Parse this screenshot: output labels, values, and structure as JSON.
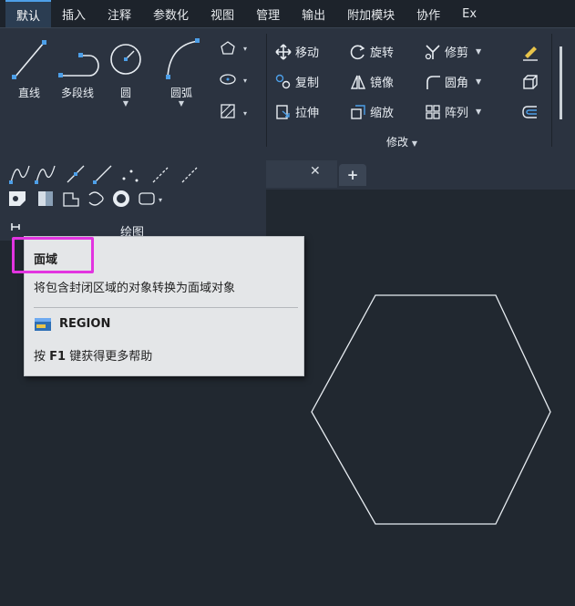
{
  "tabs": [
    {
      "label": "默认",
      "active": true
    },
    {
      "label": "插入"
    },
    {
      "label": "注释"
    },
    {
      "label": "参数化"
    },
    {
      "label": "视图"
    },
    {
      "label": "管理"
    },
    {
      "label": "输出"
    },
    {
      "label": "附加模块"
    },
    {
      "label": "协作"
    },
    {
      "label": "Ex"
    }
  ],
  "draw_panel": {
    "line": "直线",
    "polyline": "多段线",
    "circle": "圆",
    "arc": "圆弧",
    "title": "绘图"
  },
  "modify_panel": {
    "move": "移动",
    "rotate": "旋转",
    "trim": "修剪",
    "copy": "复制",
    "mirror": "镜像",
    "fillet": "圆角",
    "stretch": "拉伸",
    "scale": "缩放",
    "array": "阵列",
    "title": "修改"
  },
  "tooltip": {
    "title": "面域",
    "description": "将包含封闭区域的对象转换为面域对象",
    "command": "REGION",
    "help_prefix": "按",
    "help_key": "F1",
    "help_suffix": "键获得更多帮助"
  },
  "colors": {
    "highlight": "#e234e0",
    "accent": "#4d9fe8"
  }
}
